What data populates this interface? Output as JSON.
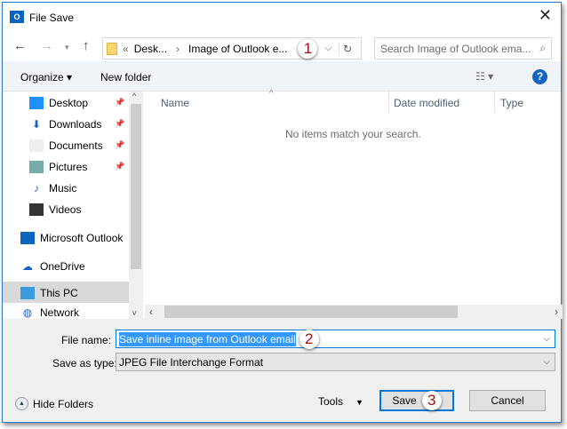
{
  "window": {
    "title": "File Save",
    "app_icon": "outlook-icon",
    "close": "✕"
  },
  "address": {
    "overflow": "«",
    "crumbs": [
      "Desk...",
      "Image of Outlook e..."
    ],
    "step": "1"
  },
  "search": {
    "placeholder": "Search Image of Outlook ema..."
  },
  "toolbar": {
    "organize": "Organize ▾",
    "new_folder": "New folder",
    "help": "?"
  },
  "sidebar": {
    "items": [
      {
        "label": "Desktop",
        "icon": "desktop-icon",
        "pinned": true
      },
      {
        "label": "Downloads",
        "icon": "download-icon",
        "pinned": true
      },
      {
        "label": "Documents",
        "icon": "documents-icon",
        "pinned": true
      },
      {
        "label": "Pictures",
        "icon": "pictures-icon",
        "pinned": true
      },
      {
        "label": "Music",
        "icon": "music-icon"
      },
      {
        "label": "Videos",
        "icon": "videos-icon"
      },
      {
        "label": "Microsoft Outlook",
        "icon": "outlook-icon"
      },
      {
        "label": "OneDrive",
        "icon": "onedrive-icon"
      },
      {
        "label": "This PC",
        "icon": "pc-icon",
        "selected": true
      },
      {
        "label": "Network",
        "icon": "network-icon"
      }
    ]
  },
  "columns": [
    "Name",
    "Date modified",
    "Type"
  ],
  "empty_message": "No items match your search.",
  "form": {
    "file_name_label": "File name:",
    "file_name_value": "Save inline image from Outlook email",
    "step2": "2",
    "type_label": "Save as type:",
    "type_value": "JPEG File Interchange Format"
  },
  "footer": {
    "hide_folders": "Hide Folders",
    "tools": "Tools",
    "save": "Save",
    "step3": "3",
    "cancel": "Cancel"
  },
  "colors": {
    "accent": "#0078d7",
    "selection": "#3399ff",
    "badge_text": "#a01010"
  }
}
